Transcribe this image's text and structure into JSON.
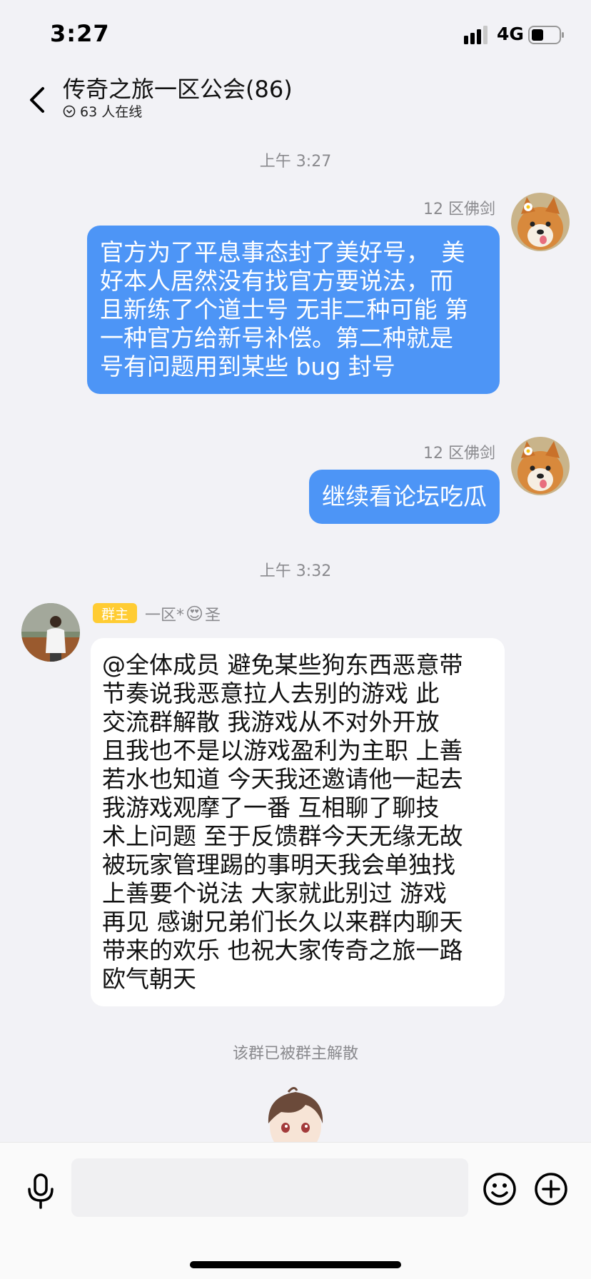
{
  "status_bar": {
    "time": "3:27",
    "network": "4G"
  },
  "header": {
    "title": "传奇之旅一区公会(86)",
    "online_count": "63 人在线"
  },
  "messages": [
    {
      "type": "timestamp",
      "text": "上午 3:27"
    },
    {
      "type": "outgoing",
      "sender": "12 区佛剑",
      "text": "官方为了平息事态封了美好号，　美\n好本人居然没有找官方要说法，而\n且新练了个道士号 无非二种可能  第\n一种官方给新号补偿。第二种就是\n号有问题用到某些 bug 封号"
    },
    {
      "type": "outgoing",
      "sender": "12 区佛剑",
      "text": "继续看论坛吃瓜"
    },
    {
      "type": "timestamp",
      "text": "上午 3:32"
    },
    {
      "type": "incoming",
      "badge": "群主",
      "sender_prefix": "一区*",
      "sender_suffix": "圣",
      "sender_emoji": "😍",
      "text": "@全体成员   避免某些狗东西恶意带\n节奏说我恶意拉人去别的游戏    此\n交流群解散    我游戏从不对外开放\n且我也不是以游戏盈利为主职   上善\n若水也知道  今天我还邀请他一起去\n我游戏观摩了一番    互相聊了聊技\n术上问题   至于反馈群今天无缘无故\n被玩家管理踢的事明天我会单独找\n上善要个说法    大家就此别过   游戏\n再见   感谢兄弟们长久以来群内聊天\n带来的欢乐  也祝大家传奇之旅一路\n欧气朝天"
    },
    {
      "type": "system",
      "text": "该群已被群主解散"
    }
  ],
  "input": {
    "placeholder": ""
  },
  "icons": [
    "signal-icon",
    "battery-icon",
    "back-arrow-icon",
    "online-status-icon",
    "microphone-icon",
    "emoji-icon",
    "plus-icon"
  ],
  "colors": {
    "outgoing_bubble": "#4d95f6",
    "badge": "#ffcc33",
    "background": "#f2f2f6"
  }
}
